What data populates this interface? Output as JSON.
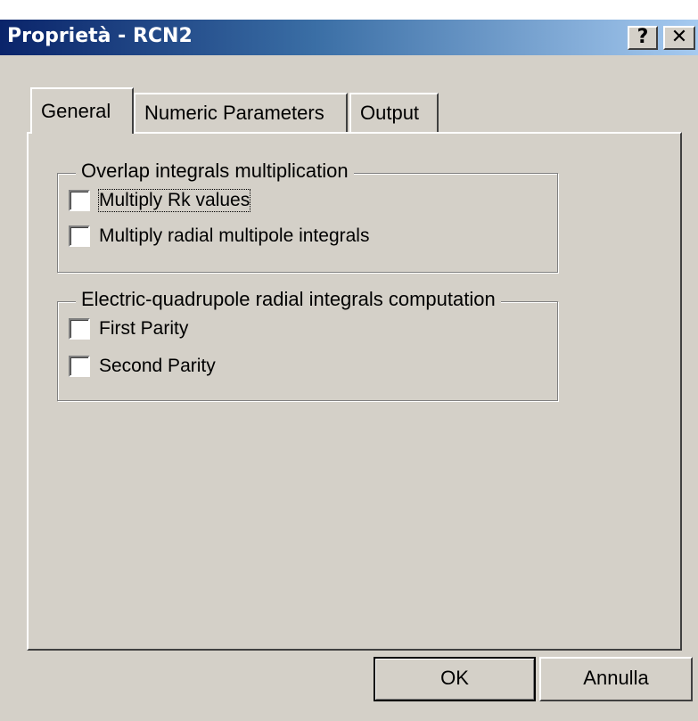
{
  "window": {
    "title": "Proprietà - RCN2",
    "help_glyph": "?",
    "close_glyph": "✕"
  },
  "tabs": [
    {
      "label": "General",
      "selected": true
    },
    {
      "label": "Numeric Parameters",
      "selected": false
    },
    {
      "label": "Output",
      "selected": false
    }
  ],
  "groups": {
    "overlap": {
      "title": "Overlap integrals multiplication",
      "options": [
        {
          "label": "Multiply Rk values",
          "checked": false
        },
        {
          "label": "Multiply radial multipole integrals",
          "checked": false
        }
      ]
    },
    "quadrupole": {
      "title": "Electric-quadrupole radial integrals computation",
      "options": [
        {
          "label": "First Parity",
          "checked": false
        },
        {
          "label": "Second Parity",
          "checked": false
        }
      ]
    }
  },
  "buttons": {
    "ok": "OK",
    "cancel": "Annulla"
  }
}
